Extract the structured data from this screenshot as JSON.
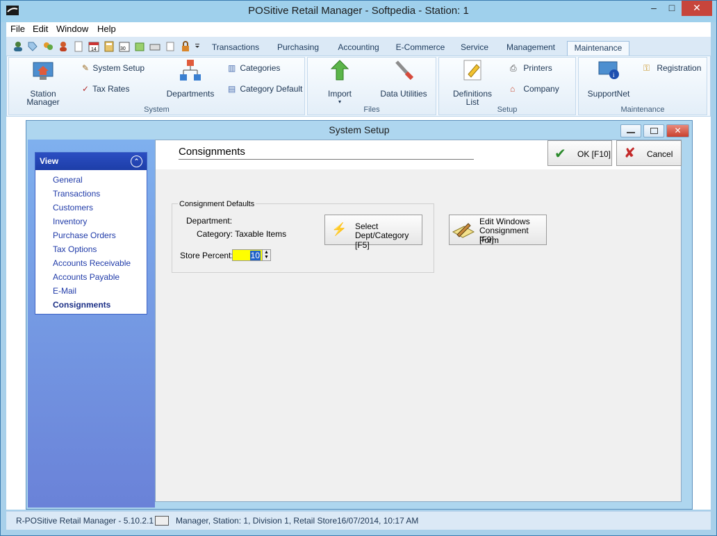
{
  "window": {
    "title": "POSitive Retail Manager - Softpedia - Station: 1",
    "minimize": "–",
    "maximize": "□",
    "close": "✕"
  },
  "menu": {
    "file": "File",
    "edit": "Edit",
    "window": "Window",
    "help": "Help"
  },
  "tabs": [
    "Transactions",
    "Purchasing",
    "Accounting",
    "E-Commerce",
    "Service",
    "Management",
    "Maintenance"
  ],
  "ribbon": {
    "station_manager": "Station Manager",
    "system_setup": "System Setup",
    "tax_rates": "Tax Rates",
    "departments": "Departments",
    "categories": "Categories",
    "category_default": "Category Default",
    "import": "Import",
    "data_utilities": "Data Utilities",
    "definitions_list": "Definitions List",
    "printers": "Printers",
    "company": "Company",
    "supportnet": "SupportNet",
    "registration": "Registration",
    "group_system": "System",
    "group_files": "Files",
    "group_setup": "Setup",
    "group_maintenance": "Maintenance"
  },
  "dialog": {
    "title": "System Setup",
    "view_title": "View",
    "view_items": [
      "General",
      "Transactions",
      "Customers",
      "Inventory",
      "Purchase Orders",
      "Tax Options",
      "Accounts Receivable",
      "Accounts Payable",
      "E-Mail",
      "Consignments"
    ],
    "selected_view": "Consignments",
    "heading": "Consignments",
    "ok_label": "OK [F10]",
    "cancel_label": "Cancel",
    "defaults_label": "Consignment Defaults",
    "department_label": "Department:",
    "category_text": "Category: Taxable Items",
    "select_button_line1": "Select",
    "select_button_line2": "Dept/Category [F5]",
    "edit_button_line1": "Edit Windows",
    "edit_button_line2": "Consignment Form",
    "edit_button_line3": "[F9]",
    "store_percent_label": "Store Percent:",
    "store_percent_value": "10"
  },
  "status": {
    "app": "R-POSitive Retail Manager - 5.10.2.1",
    "session": "Manager, Station: 1, Division 1, Retail Store",
    "datetime": "16/07/2014, 10:17 AM"
  },
  "colors": {
    "accent": "#1d3ea8",
    "highlight": "#ffff00",
    "link": "#1f3aa8"
  }
}
